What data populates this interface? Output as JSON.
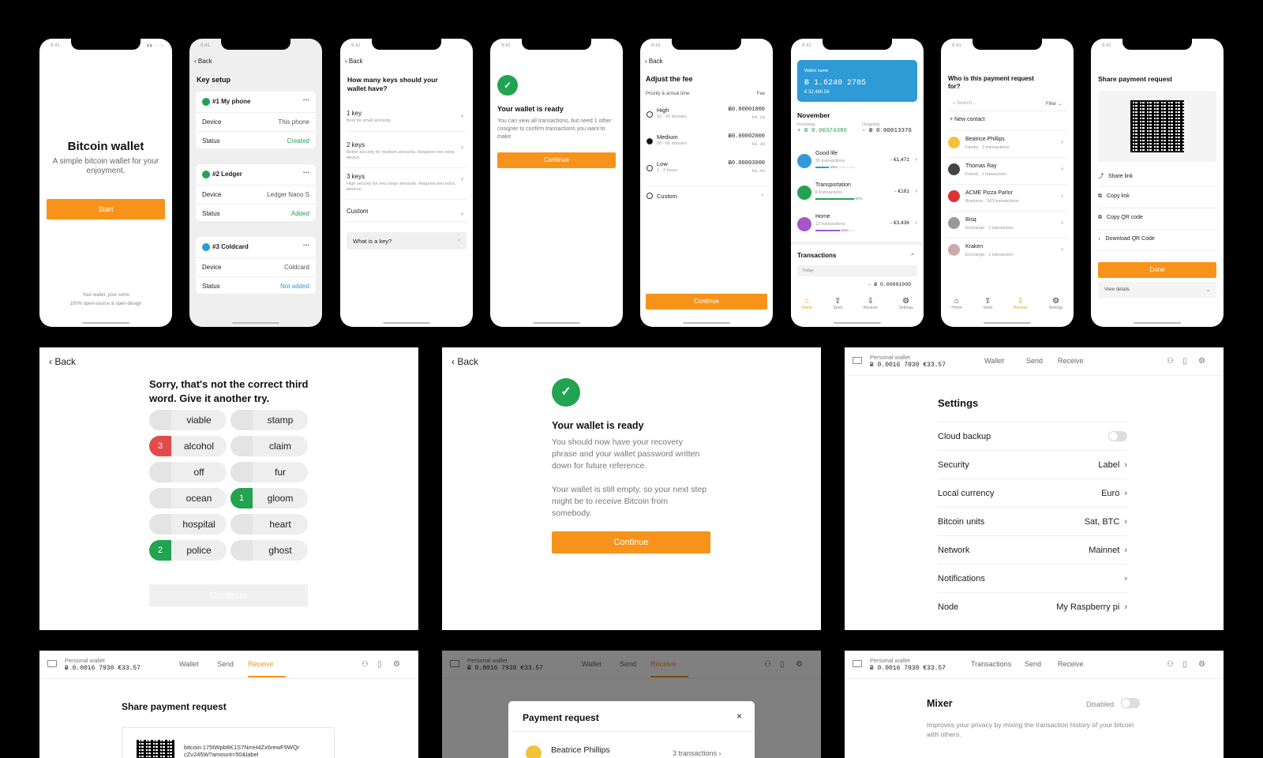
{
  "status_time": "9:41",
  "back": "Back",
  "p1": {
    "title": "Bitcoin wallet",
    "subtitle": "A simple bitcoin wallet for your enjoyment.",
    "start": "Start",
    "footer1": "Your wallet, your coins",
    "footer2": "100% open-source & open-design"
  },
  "p2": {
    "title": "Key setup",
    "device_label": "Device",
    "status_label": "Status",
    "keys": [
      {
        "name": "#1 My phone",
        "device": "This phone",
        "status": "Created"
      },
      {
        "name": "#2 Ledger",
        "device": "Ledger Nano S",
        "status": "Added"
      },
      {
        "name": "#3 Coldcard",
        "device": "Coldcard",
        "status": "Not added"
      }
    ]
  },
  "p3": {
    "title": "How many keys should your wallet have?",
    "options": [
      {
        "label": "1 key",
        "sub": "Best for small amounts."
      },
      {
        "label": "2 keys",
        "sub": "Better security for medium amounts. Requires one extra device."
      },
      {
        "label": "3 keys",
        "sub": "High security for very large amounts. Requires two extra devices."
      },
      {
        "label": "Custom",
        "sub": ""
      }
    ],
    "what": "What is a key?"
  },
  "p4": {
    "title": "Your wallet is ready",
    "text": "You can view all transactions, but need 1 other cosigner to confirm transactions you want to make.",
    "continue": "Continue"
  },
  "p5": {
    "title": "Adjust the fee",
    "col1": "Priority & arrival time",
    "col2": "Fee",
    "rows": [
      {
        "label": "High",
        "time": "10 - 20 minutes",
        "btc": "Ƀ0.00001000",
        "eur": "€0.20"
      },
      {
        "label": "Medium",
        "time": "20 - 60 minutes",
        "btc": "Ƀ0.00002000",
        "eur": "€0.30"
      },
      {
        "label": "Low",
        "time": "1 - 2 hours",
        "btc": "Ƀ0.00003000",
        "eur": "€0.40"
      }
    ],
    "custom": "Custom",
    "continue": "Continue"
  },
  "p6": {
    "wallet_label": "Wallet name",
    "balance": "Ƀ 1.6240 2785",
    "eur": "€ 32,480.56",
    "month": "November",
    "incoming_label": "Incoming",
    "incoming": "+ Ƀ 0.00374386",
    "outgoing_label": "Outgoing",
    "outgoing": "- Ƀ 0.00013376",
    "cats": [
      {
        "name": "Good life",
        "count": "35 transactions",
        "amount": "- €1,471",
        "pct": "33%",
        "progress": 0.33,
        "color": "#3498db"
      },
      {
        "name": "Transportation",
        "count": "6 transactions",
        "amount": "- €181",
        "pct": "97%",
        "progress": 0.97,
        "color": "#22a350"
      },
      {
        "name": "Home",
        "count": "12 transactions",
        "amount": "- €3,436",
        "pct": "61%",
        "progress": 0.61,
        "color": "#a855c7"
      }
    ],
    "tx_title": "Transactions",
    "today": "Today",
    "tx_amount": "- Ƀ 0.00001000"
  },
  "tabs": [
    "Home",
    "Send",
    "Receive",
    "Settings"
  ],
  "p7": {
    "title": "Who is this payment request for?",
    "search": "Search...",
    "filter": "Filter",
    "new_contact": "New contact",
    "contacts": [
      {
        "name": "Beatrice Phillips",
        "sub": "Family · 3 transactions"
      },
      {
        "name": "Thomas Ray",
        "sub": "Friend · 1 transaction"
      },
      {
        "name": "ACME Pizza Parlor",
        "sub": "Business · 563 transactions"
      },
      {
        "name": "Bisq",
        "sub": "Exchange · 1 transaction"
      },
      {
        "name": "Kraken",
        "sub": "Exchange · 1 transaction"
      }
    ]
  },
  "p8": {
    "title": "Share payment request",
    "actions": [
      "Share link",
      "Copy link",
      "Copy QR code",
      "Download QR Code"
    ],
    "done": "Done",
    "details": "View details"
  },
  "d1": {
    "message": "Sorry, that's not the correct third word. Give it another try.",
    "left": [
      {
        "w": "viable",
        "n": ""
      },
      {
        "w": "alcohol",
        "n": "3"
      },
      {
        "w": "off",
        "n": ""
      },
      {
        "w": "ocean",
        "n": ""
      },
      {
        "w": "hospital",
        "n": ""
      },
      {
        "w": "police",
        "n": "2"
      }
    ],
    "right": [
      {
        "w": "stamp",
        "n": ""
      },
      {
        "w": "claim",
        "n": ""
      },
      {
        "w": "fur",
        "n": ""
      },
      {
        "w": "gloom",
        "n": "1"
      },
      {
        "w": "heart",
        "n": ""
      },
      {
        "w": "ghost",
        "n": ""
      }
    ],
    "continue": "Continue"
  },
  "d2": {
    "title": "Your wallet is ready",
    "p1": "You should now have your recovery phrase and your wallet password written down for future reference.",
    "p2": "Your wallet is still empty, so your next step might be to receive Bitcoin from somebody.",
    "continue": "Continue"
  },
  "nav": {
    "wallet_name": "Personal wallet",
    "balance": "Ƀ 0.0016 7930   €33.57",
    "wallet": "Wallet",
    "send": "Send",
    "receive": "Receive",
    "transactions": "Transactions"
  },
  "d3": {
    "title": "Settings",
    "rows": [
      {
        "label": "Cloud backup",
        "value": ""
      },
      {
        "label": "Security",
        "value": "Label"
      },
      {
        "label": "Local currency",
        "value": "Euro"
      },
      {
        "label": "Bitcoin units",
        "value": "Sat, BTC"
      },
      {
        "label": "Network",
        "value": "Mainnet"
      },
      {
        "label": "Notifications",
        "value": ""
      },
      {
        "label": "Node",
        "value": "My Raspberry pi"
      }
    ]
  },
  "d4": {
    "title": "Share payment request",
    "uri": "bitcoin:175tWpb8K1S7NmH4Zx6rewF9WQrcZv245W?amount=50&label"
  },
  "d5": {
    "modal_title": "Payment request",
    "contact": "Beatrice Phillips",
    "count": "3 transactions"
  },
  "d6": {
    "title": "Mixer",
    "state": "Disabled",
    "desc": "Improves your privacy by mixing the transaction history of your bitcoin with others."
  }
}
